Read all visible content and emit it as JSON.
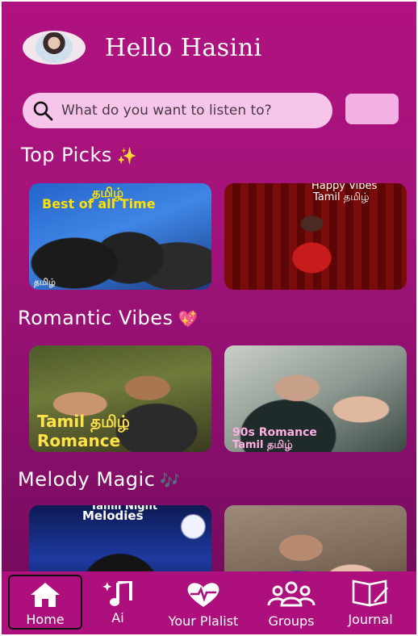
{
  "header": {
    "greeting": "Hello Hasini"
  },
  "search": {
    "placeholder": "What do you want to listen to?"
  },
  "sections": [
    {
      "title": "Top Picks",
      "emoji": "✨",
      "cards": [
        {
          "caption_lines": [
            "தமிழ்",
            "Best of all Time"
          ],
          "footer": "தமிழ்"
        },
        {
          "caption_lines": [
            "Happy Vibes",
            "Tamil தமிழ்"
          ]
        }
      ]
    },
    {
      "title": "Romantic Vibes",
      "emoji": "💖",
      "cards": [
        {
          "caption_lines": [
            "Tamil தமிழ்",
            "Romance"
          ]
        },
        {
          "caption_lines": [
            "90s Romance",
            "Tamil தமிழ்"
          ]
        }
      ]
    },
    {
      "title": "Melody Magic",
      "emoji": "🎶",
      "cards": [
        {
          "caption_lines": [
            "Tamil Night",
            "Melodies"
          ]
        },
        {
          "caption_lines": []
        }
      ]
    }
  ],
  "nav": {
    "items": [
      {
        "label": "Home",
        "icon": "home-icon",
        "active": true
      },
      {
        "label": "Ai",
        "icon": "ai-music-icon"
      },
      {
        "label": "Your Plalist",
        "icon": "heart-pulse-icon"
      },
      {
        "label": "Groups",
        "icon": "groups-icon"
      },
      {
        "label": "Journal",
        "icon": "journal-icon"
      }
    ]
  },
  "colors": {
    "background_top": "#b0127f",
    "background_bottom": "#6e0a59",
    "search_bg": "#f7c5ea",
    "nav_bg": "#ad0f7c",
    "text": "#ffffff"
  }
}
